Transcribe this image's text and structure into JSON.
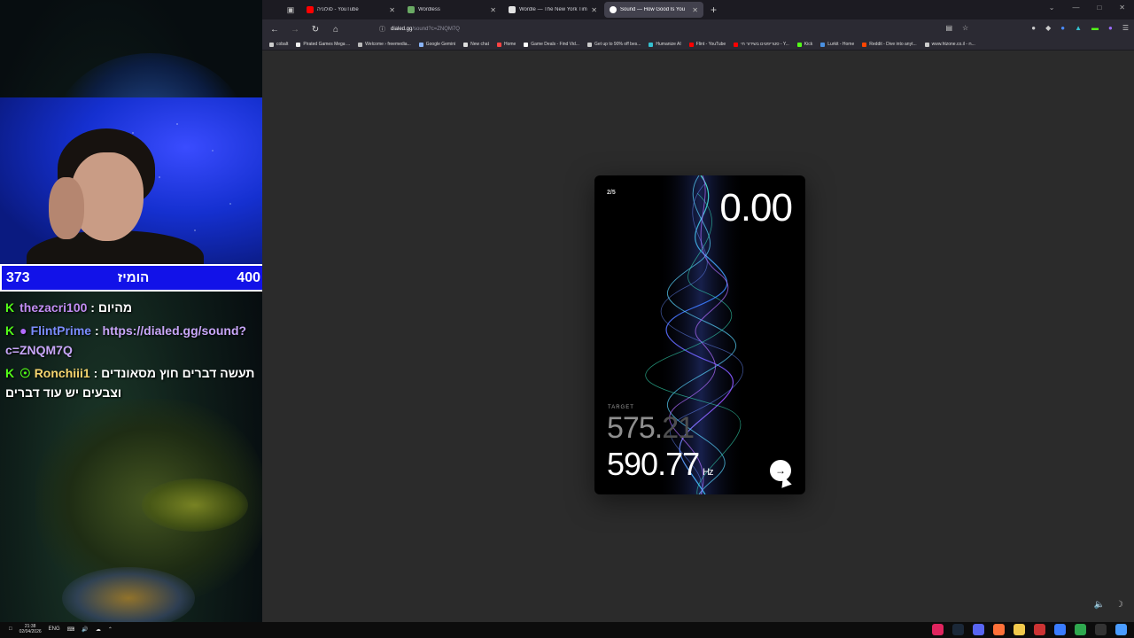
{
  "stream": {
    "score": {
      "left": "373",
      "middle": "הומיז",
      "right": "400"
    },
    "chat": [
      {
        "user": "thezacri100",
        "text": " : מהיום"
      },
      {
        "user": "FlintPrime",
        "text": " : ",
        "link": "https://dialed.gg/sound?c=ZNQM7Q"
      },
      {
        "user": "Ronchiii1",
        "text": " : תעשה דברים חוץ מסאונדים וצבעים יש עוד דברים"
      }
    ]
  },
  "browser": {
    "tabs": [
      {
        "title": "סולוניה - YouTube",
        "color": "#ff0000"
      },
      {
        "title": "Wordless",
        "color": "#6aaa64"
      },
      {
        "title": "Wordle — The New York Times",
        "color": "#e3e3e3"
      },
      {
        "title": "Sound — How Good Is You",
        "color": "#ffffff",
        "active": true
      }
    ],
    "url": {
      "host": "dialed.gg",
      "path": "/sound?c=ZNQM7Q"
    },
    "bookmarks": [
      {
        "label": "cobalt",
        "color": "#cccccc"
      },
      {
        "label": "Pirated Games Mega ...",
        "color": "#eeeeee"
      },
      {
        "label": "Welcome › freemedia...",
        "color": "#bbbbbb"
      },
      {
        "label": "Google Gemini",
        "color": "#8ab4f8"
      },
      {
        "label": "New chat",
        "color": "#dddddd"
      },
      {
        "label": "Home",
        "color": "#ff4444"
      },
      {
        "label": "Game Deals - Find Vid...",
        "color": "#ffffff"
      },
      {
        "label": "Get up to 90% off bes...",
        "color": "#cccccc"
      },
      {
        "label": "Humanize AI",
        "color": "#35c0d0"
      },
      {
        "label": "Flint - YouTube",
        "color": "#ff0000"
      },
      {
        "label": "סטריפטים בשידור חי - Y...",
        "color": "#ff0000"
      },
      {
        "label": "Kick",
        "color": "#53fc18"
      },
      {
        "label": "Lurkit - Home",
        "color": "#4a90e2"
      },
      {
        "label": "Reddit - Dive into anyt...",
        "color": "#ff4500"
      },
      {
        "label": "www.htzone.co.il - ח...",
        "color": "#cccccc"
      }
    ]
  },
  "game": {
    "progress": "2/5",
    "timer": "0.00",
    "target_label": "TARGET",
    "target_int": "575.",
    "target_dec": "21",
    "current": "590.77",
    "unit": "Hz"
  },
  "taskbar": {
    "lang": "ENG",
    "time": "21:38",
    "date": "02/04/2026"
  },
  "colors": {
    "accent_blue": "#1212e8",
    "kick_green": "#53fc18",
    "card_bg": "#000000",
    "page_bg": "#2b2b2b"
  }
}
